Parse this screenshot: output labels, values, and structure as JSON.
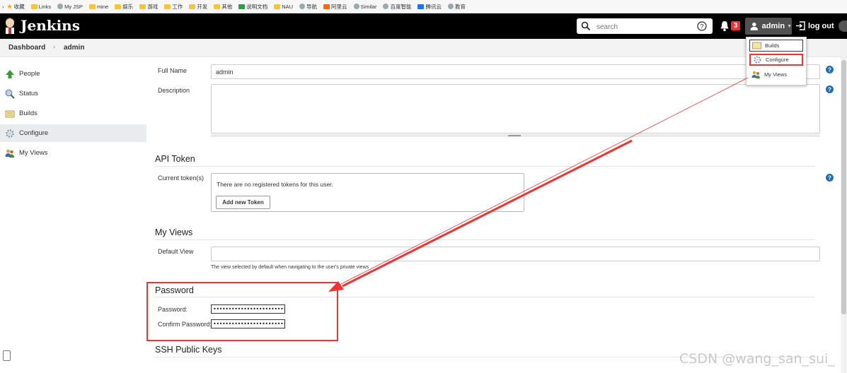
{
  "bookmarks": [
    "收藏",
    "Links",
    "My JSP",
    "mine",
    "娱乐",
    "游戏",
    "工作",
    "开发",
    "其他",
    "说明文档",
    "NAU",
    "导航",
    "阿里云",
    "Similar",
    "百度智能",
    "腾讯云",
    "教育"
  ],
  "header": {
    "brand": "Jenkins",
    "search_placeholder": "search",
    "notification_count": "3",
    "user": "admin",
    "logout": "log out"
  },
  "breadcrumb": {
    "items": [
      "Dashboard",
      "admin"
    ]
  },
  "sidebar": {
    "items": [
      {
        "label": "People",
        "icon": "up-arrow-icon"
      },
      {
        "label": "Status",
        "icon": "magnifier-icon"
      },
      {
        "label": "Builds",
        "icon": "notepad-icon"
      },
      {
        "label": "Configure",
        "icon": "gear-icon",
        "active": true
      },
      {
        "label": "My Views",
        "icon": "people-icon"
      }
    ]
  },
  "form": {
    "full_name_label": "Full Name",
    "full_name_value": "admin",
    "description_label": "Description",
    "api_token": {
      "title": "API Token",
      "current_label": "Current token(s)",
      "empty_message": "There are no registered tokens for this user.",
      "add_button": "Add new Token"
    },
    "my_views": {
      "title": "My Views",
      "default_view_label": "Default View",
      "hint": "The view selected by default when navigating to the user's private views"
    },
    "password": {
      "title": "Password",
      "password_label": "Password:",
      "confirm_label": "Confirm Password:",
      "mask": "••••••••••••••••••••••••••••••••"
    },
    "ssh_title": "SSH Public Keys"
  },
  "user_menu": {
    "items": [
      "Builds",
      "Configure",
      "My Views"
    ]
  },
  "watermark": "CSDN @wang_san_sui_",
  "colors": {
    "header_bg": "#000000",
    "highlight_red": "#e33333",
    "active_sidebar": "#e9ecef"
  }
}
